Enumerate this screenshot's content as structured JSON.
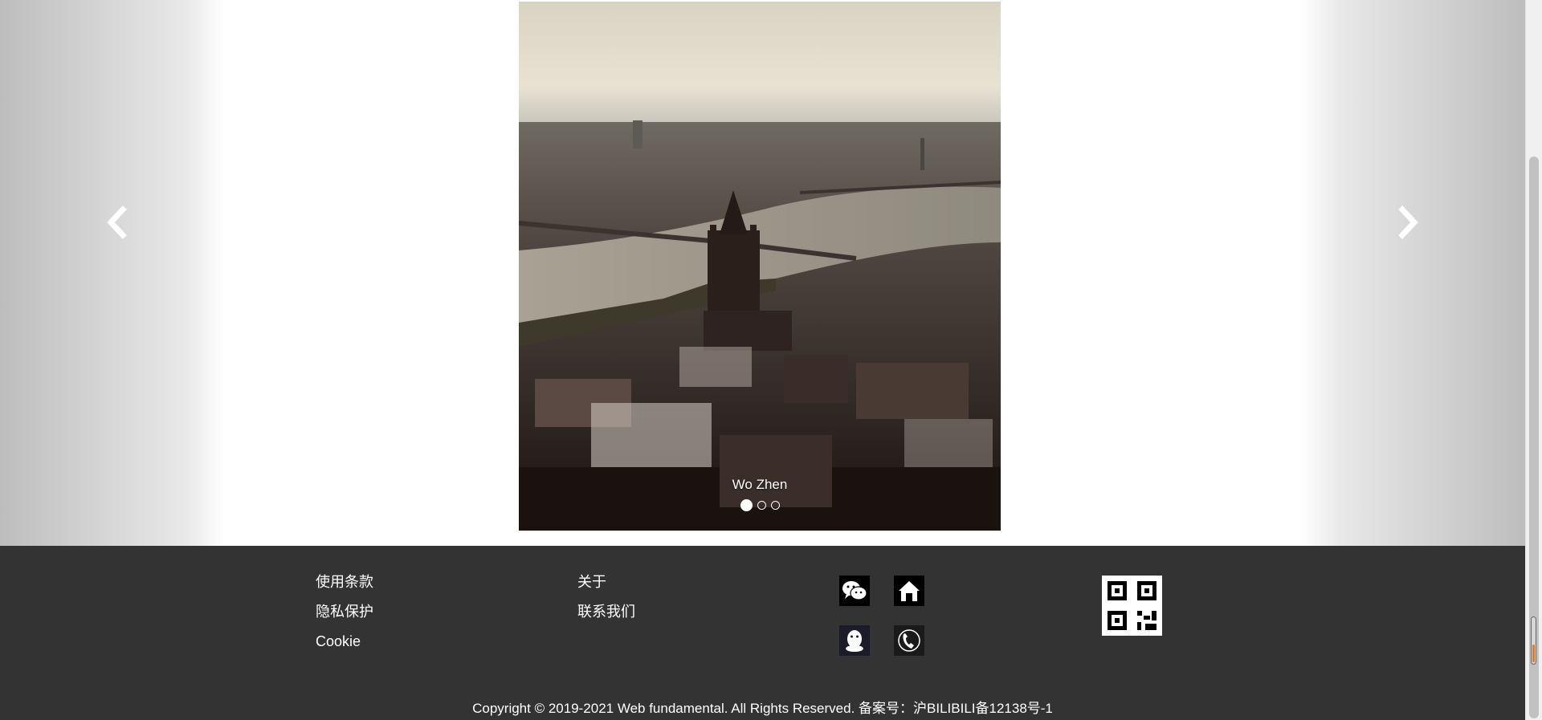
{
  "carousel": {
    "caption": "Wo Zhen",
    "slide_count": 3,
    "active_index": 0,
    "prev_icon": "chevron-left-icon",
    "next_icon": "chevron-right-icon"
  },
  "footer": {
    "links_col1": [
      "使用条款",
      "隐私保护",
      "Cookie"
    ],
    "links_col2": [
      "关于",
      "联系我们"
    ],
    "social_icons": [
      "wechat-icon",
      "home-icon",
      "qq-icon",
      "phone-icon"
    ],
    "qr_icon": "qr-code-icon",
    "copyright": "Copyright © 2019-2021 Web fundamental. All Rights Reserved. 备案号：沪BILIBILI备12138号-1",
    "background": "#333333"
  }
}
